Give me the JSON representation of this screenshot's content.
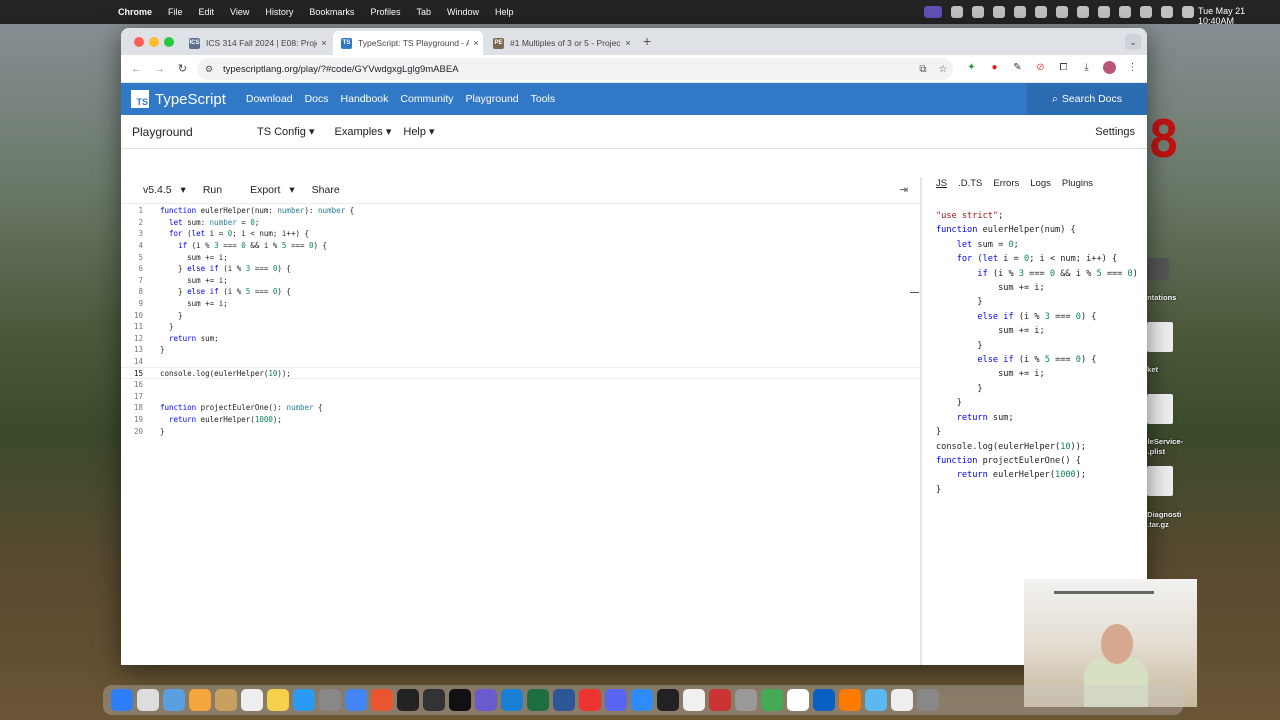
{
  "menubar": {
    "app": "Chrome",
    "items": [
      "File",
      "Edit",
      "View",
      "History",
      "Bookmarks",
      "Profiles",
      "Tab",
      "Window",
      "Help"
    ],
    "clock": "Tue May 21  10:40AM"
  },
  "tabs": [
    {
      "favicon": "ICS",
      "title": "ICS 314 Fall 2024 | E08: Proje",
      "active": false
    },
    {
      "favicon": "TS",
      "title": "TypeScript: TS Playground - A",
      "active": true
    },
    {
      "favicon": "PE",
      "title": "#1 Multiples of 3 or 5 - Projec",
      "active": false
    }
  ],
  "address": {
    "url": "typescriptlang.org/play/?#code/GYVwdgxgLglg9mABEA"
  },
  "ts_nav": {
    "logo": "TypeScript",
    "links": [
      "Download",
      "Docs",
      "Handbook",
      "Community",
      "Playground",
      "Tools"
    ],
    "search": "Search Docs"
  },
  "playground": {
    "title": "Playground",
    "menus": [
      "TS Config",
      "Examples",
      "Help"
    ],
    "settings": "Settings",
    "version": "v5.4.5",
    "run": "Run",
    "export": "Export",
    "share": "Share",
    "collapse_icon": "collapse-icon"
  },
  "editor": {
    "current_line": 15,
    "lines": [
      "function eulerHelper(num: number): number {",
      "  let sum: number = 0;",
      "  for (let i = 0; i < num; i++) {",
      "    if (i % 3 === 0 && i % 5 === 0) {",
      "      sum += i;",
      "    } else if (i % 3 === 0) {",
      "      sum += i;",
      "    } else if (i % 5 === 0) {",
      "      sum += i;",
      "    }",
      "  }",
      "  return sum;",
      "}",
      "",
      "console.log(eulerHelper(10));",
      "",
      "",
      "function projectEulerOne(): number {",
      "  return eulerHelper(1000);",
      "}"
    ]
  },
  "output_tabs": [
    "JS",
    ".D.TS",
    "Errors",
    "Logs",
    "Plugins"
  ],
  "output_lines": [
    "\"use strict\";",
    "function eulerHelper(num) {",
    "    let sum = 0;",
    "    for (let i = 0; i < num; i++) {",
    "        if (i % 3 === 0 && i % 5 === 0) {",
    "            sum += i;",
    "        }",
    "        else if (i % 3 === 0) {",
    "            sum += i;",
    "        }",
    "        else if (i % 5 === 0) {",
    "            sum += i;",
    "        }",
    "    }",
    "    return sum;",
    "}",
    "console.log(eulerHelper(10));",
    "function projectEulerOne() {",
    "    return eulerHelper(1000);",
    "}"
  ],
  "desktop": {
    "labels": [
      "entations",
      "cket",
      "gleService-",
      "o.plist",
      "sDiagnosti",
      "...tar.gz"
    ]
  },
  "colors": {
    "ts_blue": "#3178c6",
    "keyword": "#0000ff",
    "number": "#098658",
    "type": "#267f99",
    "string": "#a31515"
  }
}
